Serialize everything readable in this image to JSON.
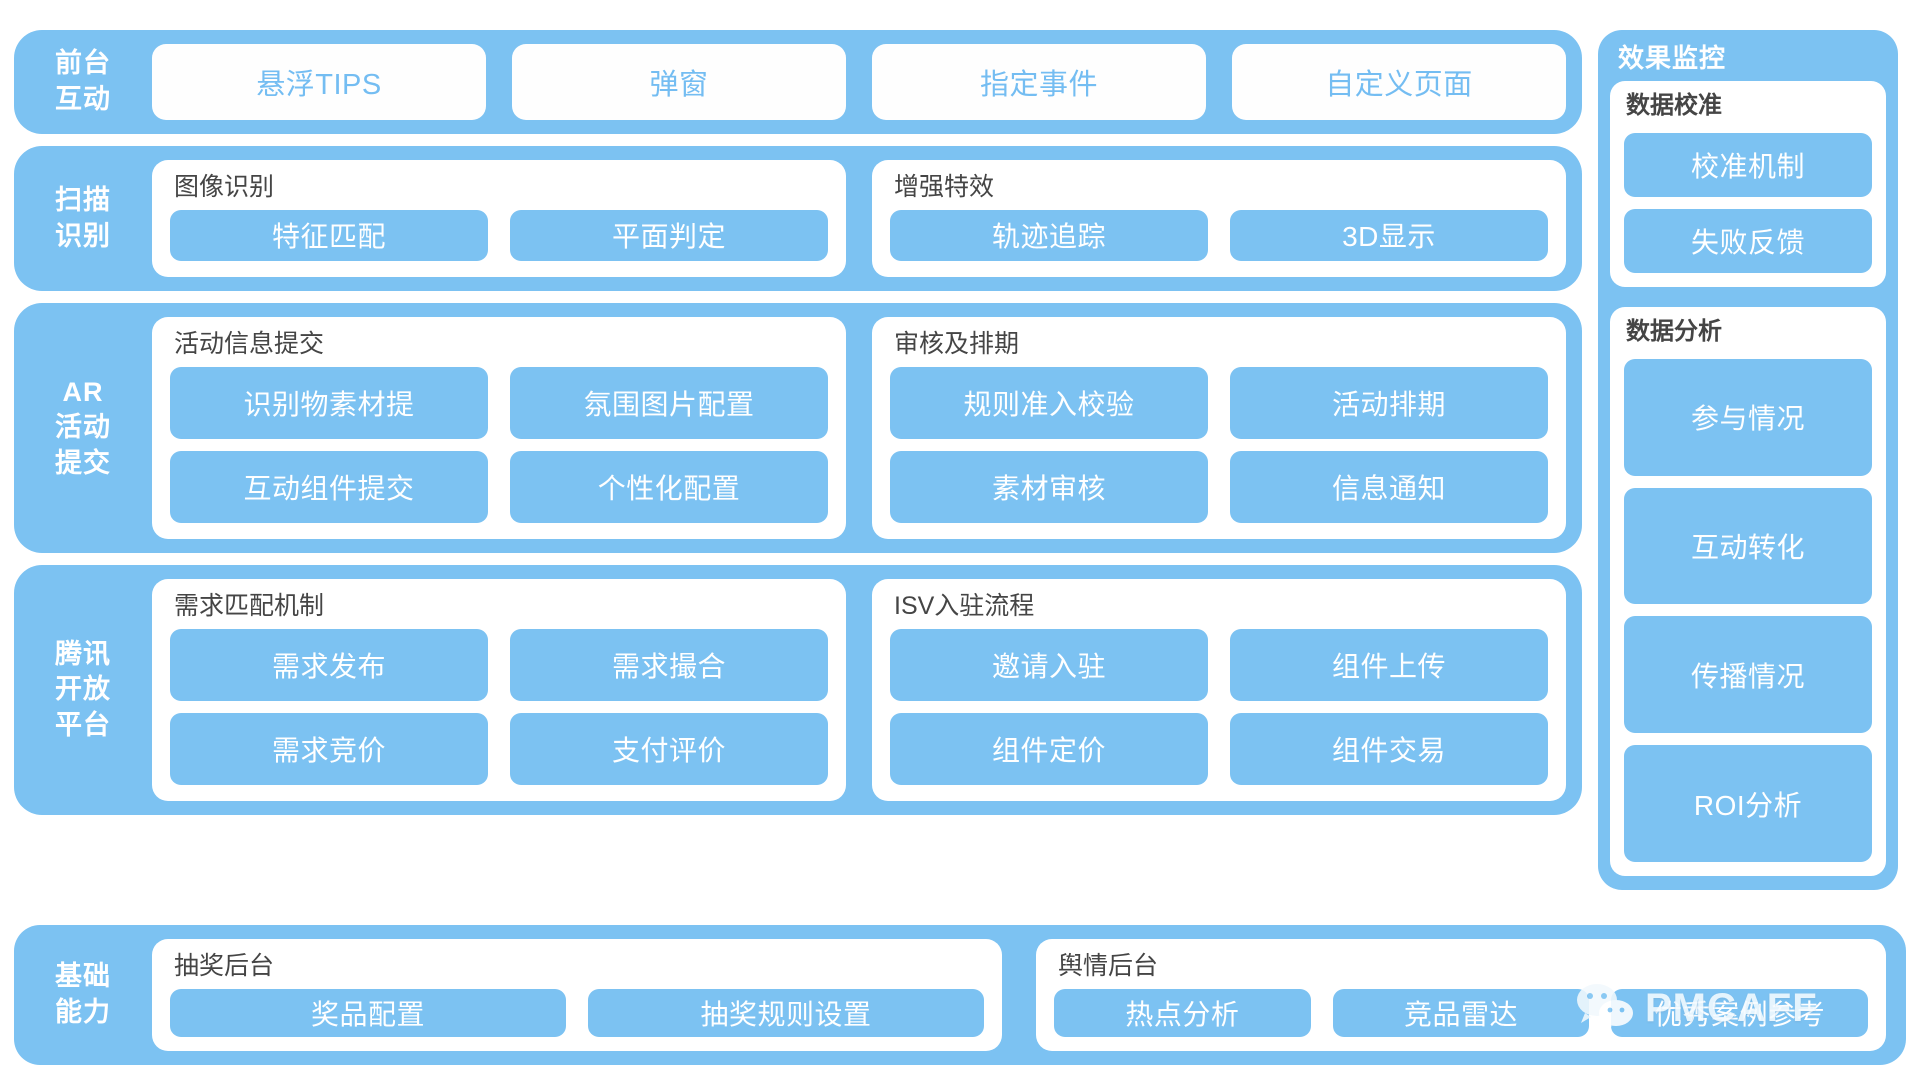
{
  "diagram": {
    "rows": [
      {
        "id": "front-interaction",
        "label": "前台\n互动",
        "label_line1": "前台",
        "label_line2": "互动",
        "style": "white-pills",
        "pills": [
          "悬浮TIPS",
          "弹窗",
          "指定事件",
          "自定义页面"
        ]
      },
      {
        "id": "scan-recognition",
        "label_line1": "扫描",
        "label_line2": "识别",
        "style": "group-cards",
        "groups": [
          {
            "title": "图像识别",
            "chips": [
              "特征匹配",
              "平面判定"
            ]
          },
          {
            "title": "增强特效",
            "chips": [
              "轨迹追踪",
              "3D显示"
            ]
          }
        ]
      },
      {
        "id": "ar-activity-submit",
        "label_line1": "AR",
        "label_line2": "活动",
        "label_line3": "提交",
        "style": "group-cards",
        "groups": [
          {
            "title": "活动信息提交",
            "chips": [
              "识别物素材提",
              "氛围图片配置",
              "互动组件提交",
              "个性化配置"
            ]
          },
          {
            "title": "审核及排期",
            "chips": [
              "规则准入校验",
              "活动排期",
              "素材审核",
              "信息通知"
            ]
          }
        ]
      },
      {
        "id": "tencent-open-platform",
        "label_line1": "腾讯",
        "label_line2": "开放",
        "label_line3": "平台",
        "style": "group-cards",
        "groups": [
          {
            "title": "需求匹配机制",
            "chips": [
              "需求发布",
              "需求撮合",
              "需求竞价",
              "支付评价"
            ]
          },
          {
            "title": "ISV入驻流程",
            "chips": [
              "邀请入驻",
              "组件上传",
              "组件定价",
              "组件交易"
            ]
          }
        ]
      }
    ],
    "bottom_row": {
      "id": "basic-capability",
      "label_line1": "基础",
      "label_line2": "能力",
      "groups": [
        {
          "title": "抽奖后台",
          "chips": [
            "奖品配置",
            "抽奖规则设置"
          ]
        },
        {
          "title": "舆情后台",
          "chips": [
            "热点分析",
            "竞品雷达",
            "优秀案例参考"
          ]
        }
      ]
    },
    "right_panel": {
      "id": "effect-monitoring",
      "title": "效果监控",
      "cards": [
        {
          "title": "数据校准",
          "chips": [
            "校准机制",
            "失败反馈"
          ]
        },
        {
          "title": "数据分析",
          "chips": [
            "参与情况",
            "互动转化",
            "传播情况",
            "ROI分析"
          ]
        }
      ]
    },
    "watermark": {
      "text": "PMCAFF",
      "icon": "wechat-icon"
    },
    "colors": {
      "blue": "#7cc2f2",
      "white": "#ffffff",
      "title_gray": "#454545",
      "pill_text_blue": "#74bdf2"
    }
  }
}
